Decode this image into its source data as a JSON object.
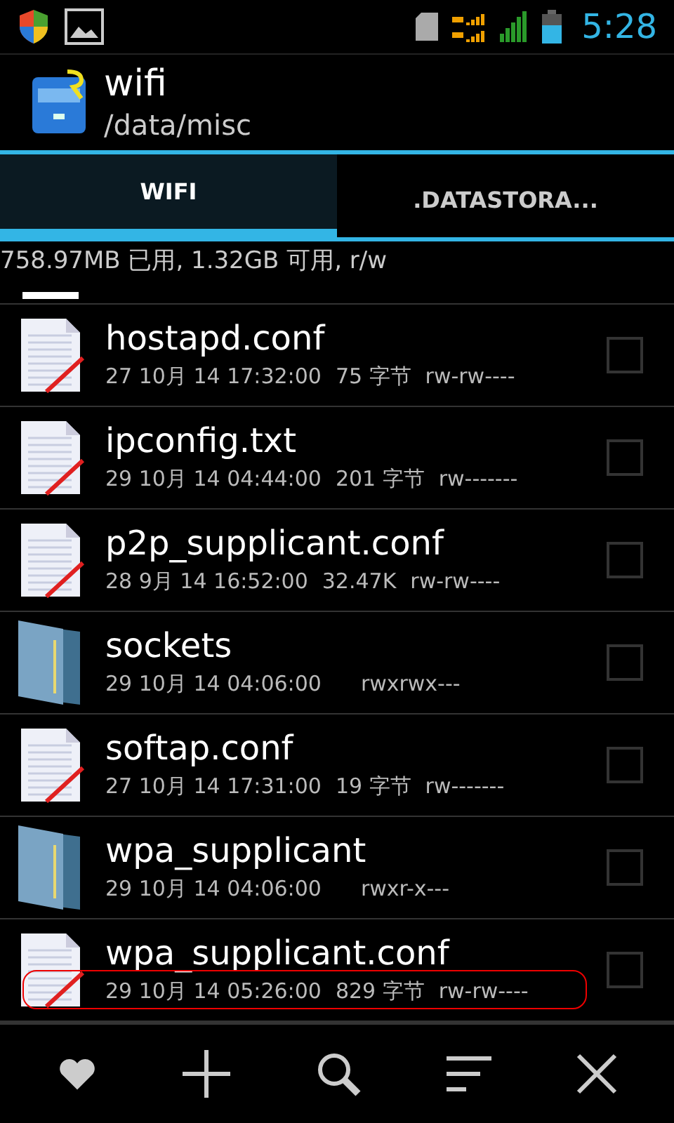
{
  "status_bar": {
    "time": "5:28"
  },
  "header": {
    "title": "wifi",
    "path": "/data/misc"
  },
  "tabs": [
    {
      "label": "WIFI",
      "selected": true
    },
    {
      "label": ".DATASTORA...",
      "selected": false
    }
  ],
  "storage_info": "758.97MB 已用, 1.32GB 可用, r/w",
  "files": [
    {
      "kind": "file",
      "name": "hostapd.conf",
      "date": "27 10月 14 17:32:00",
      "size": "75 字节",
      "permissions": "rw-rw----",
      "checked": false,
      "highlighted": false
    },
    {
      "kind": "file",
      "name": "ipconfig.txt",
      "date": "29 10月 14 04:44:00",
      "size": "201 字节",
      "permissions": "rw-------",
      "checked": false,
      "highlighted": false
    },
    {
      "kind": "file",
      "name": "p2p_supplicant.conf",
      "date": "28 9月 14 16:52:00",
      "size": "32.47K",
      "permissions": "rw-rw----",
      "checked": false,
      "highlighted": false
    },
    {
      "kind": "folder",
      "name": "sockets",
      "date": "29 10月 14 04:06:00",
      "permissions": "rwxrwx---",
      "checked": false,
      "highlighted": false
    },
    {
      "kind": "file",
      "name": "softap.conf",
      "date": "27 10月 14 17:31:00",
      "size": "19 字节",
      "permissions": "rw-------",
      "checked": false,
      "highlighted": false
    },
    {
      "kind": "folder",
      "name": "wpa_supplicant",
      "date": "29 10月 14 04:06:00",
      "permissions": "rwxr-x---",
      "checked": false,
      "highlighted": false
    },
    {
      "kind": "file",
      "name": "wpa_supplicant.conf",
      "date": "29 10月 14 05:26:00",
      "size": "829 字节",
      "permissions": "rw-rw----",
      "checked": false,
      "highlighted": true
    }
  ]
}
